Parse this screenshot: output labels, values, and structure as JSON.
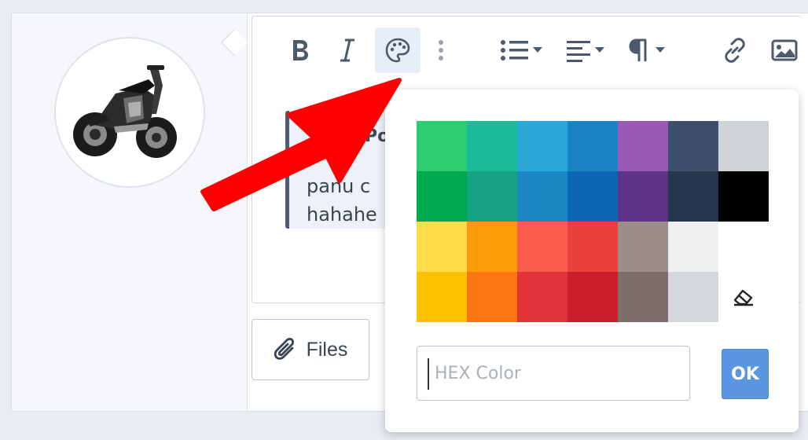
{
  "editor": {
    "quote": {
      "author_partial": "Po",
      "line1": "panu c",
      "line2": "hahahe"
    },
    "files_label": "Files"
  },
  "toolbar": {
    "buttons": [
      {
        "name": "bold",
        "icon": "bold-icon"
      },
      {
        "name": "italic",
        "icon": "italic-icon"
      },
      {
        "name": "text-color",
        "icon": "palette-icon",
        "active": true
      },
      {
        "name": "more",
        "icon": "more-vertical-icon"
      },
      {
        "name": "list",
        "icon": "list-icon"
      },
      {
        "name": "align",
        "icon": "align-left-icon"
      },
      {
        "name": "paragraph",
        "icon": "paragraph-icon"
      },
      {
        "name": "link",
        "icon": "link-icon"
      },
      {
        "name": "image",
        "icon": "image-icon"
      }
    ]
  },
  "color_picker": {
    "swatches": [
      [
        "#2ecc71",
        "#1abc9c",
        "#2aa8d8",
        "#1a83c4",
        "#9b59b6",
        "#3e4f6e",
        "#cfd3d8"
      ],
      [
        "#00a84f",
        "#15a382",
        "#1a88c3",
        "#0d65b5",
        "#5e3389",
        "#26364f",
        "#000000"
      ],
      [
        "#fedc4a",
        "#fd9c08",
        "#fb5d4d",
        "#eb3f3a",
        "#9b8e88",
        "#efefef",
        null
      ],
      [
        "#fec100",
        "#fd7513",
        "#e0333a",
        "#c81f2a",
        "#7c6e6a",
        "#d4d8dc",
        "eraser"
      ]
    ],
    "hex_placeholder": "HEX Color",
    "hex_value": "",
    "ok_label": "OK"
  },
  "colors": {
    "accent": "#5b97e0",
    "annotation_arrow": "#ff0000",
    "toolbar_icon": "#4c5a6e"
  }
}
